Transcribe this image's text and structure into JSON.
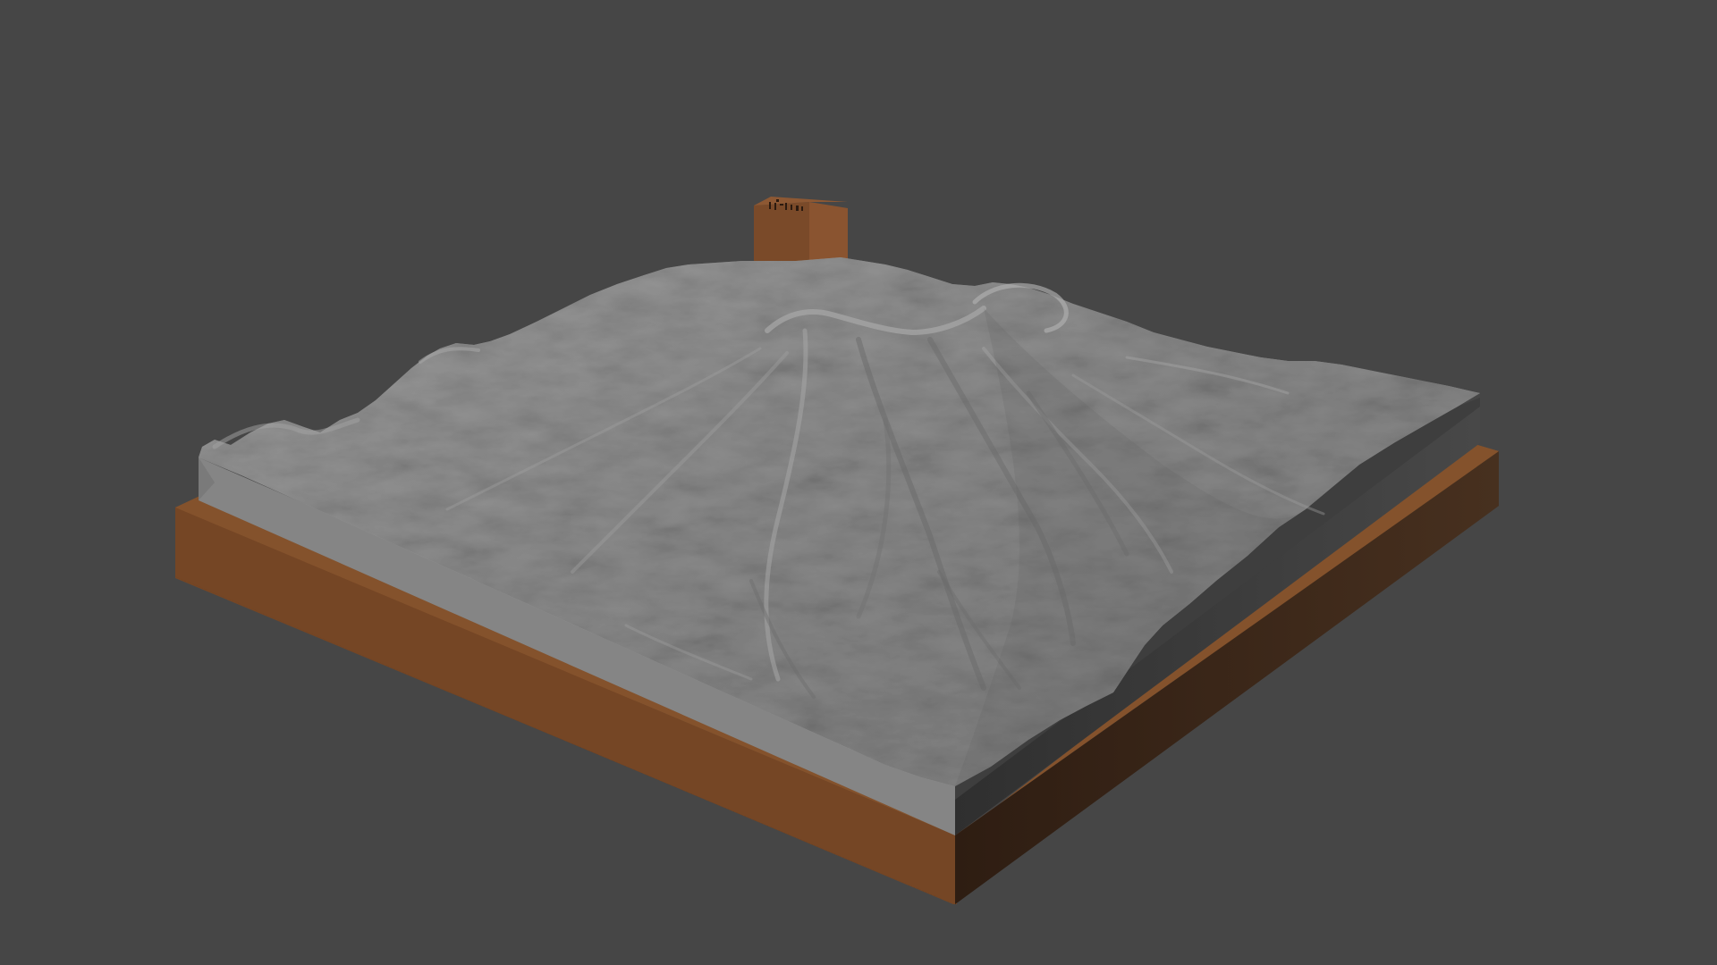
{
  "scene": {
    "background_color": "#464646",
    "model": {
      "terrain_color": "#8c8c8c",
      "terrain_side_color": "#6e6e6e",
      "terrain_dark_side_color": "#3a3a3a",
      "base_front_color": "#774726",
      "base_top_color": "#82502b",
      "base_dark_side_color": "#3a2416",
      "label_block_color": "#7a4a29",
      "label_block_glyphs_icon": "engraved-marker-glyphs"
    }
  }
}
